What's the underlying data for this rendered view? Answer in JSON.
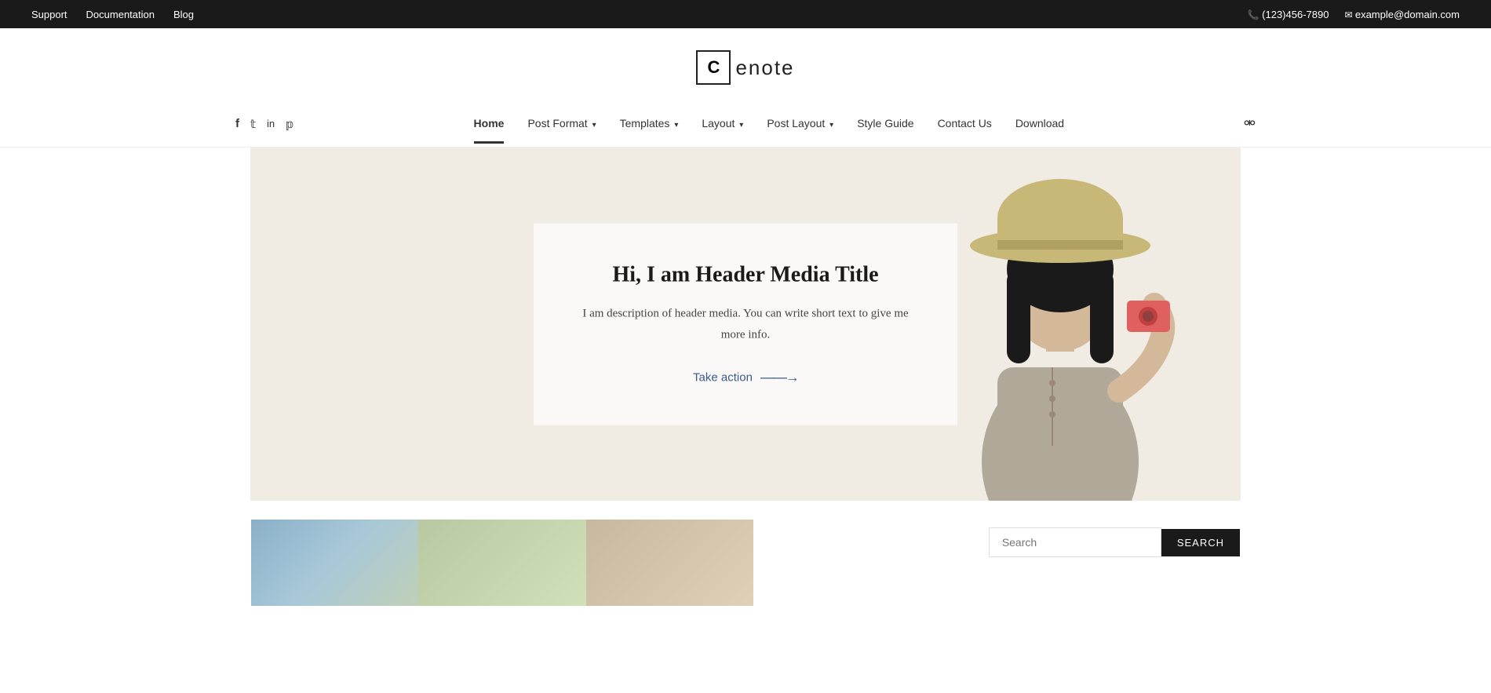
{
  "topbar": {
    "links": [
      {
        "label": "Support",
        "id": "support"
      },
      {
        "label": "Documentation",
        "id": "documentation"
      },
      {
        "label": "Blog",
        "id": "blog"
      }
    ],
    "phone": "(123)456-7890",
    "email": "example@domain.com"
  },
  "logo": {
    "letter": "C",
    "name": "enote"
  },
  "social": [
    {
      "icon": "f",
      "name": "facebook"
    },
    {
      "icon": "t",
      "name": "twitter"
    },
    {
      "icon": "in",
      "name": "linkedin"
    },
    {
      "icon": "p",
      "name": "pinterest"
    }
  ],
  "nav": {
    "items": [
      {
        "label": "Home",
        "id": "home",
        "active": true,
        "has_dropdown": false
      },
      {
        "label": "Post Format",
        "id": "post-format",
        "active": false,
        "has_dropdown": true
      },
      {
        "label": "Templates",
        "id": "templates",
        "active": false,
        "has_dropdown": true
      },
      {
        "label": "Layout",
        "id": "layout",
        "active": false,
        "has_dropdown": true
      },
      {
        "label": "Post Layout",
        "id": "post-layout",
        "active": false,
        "has_dropdown": true
      },
      {
        "label": "Style Guide",
        "id": "style-guide",
        "active": false,
        "has_dropdown": false
      },
      {
        "label": "Contact Us",
        "id": "contact-us",
        "active": false,
        "has_dropdown": false
      },
      {
        "label": "Download",
        "id": "download",
        "active": false,
        "has_dropdown": false
      }
    ]
  },
  "hero": {
    "title": "Hi, I am Header Media Title",
    "description": "I am description of header media. You can write short text to give me more info.",
    "cta_label": "Take action",
    "cta_arrow": "———>"
  },
  "search": {
    "placeholder": "Search",
    "button_label": "SEARCH"
  }
}
